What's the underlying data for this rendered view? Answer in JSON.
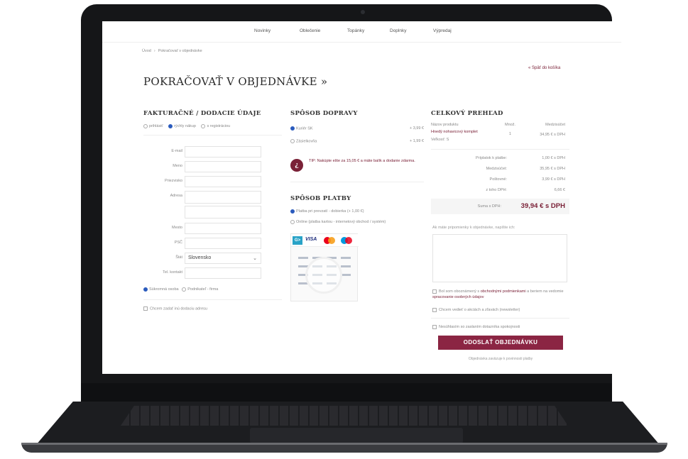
{
  "nav": {
    "items": [
      "Novinky",
      "Oblečenie",
      "Topánky",
      "Doplnky",
      "Výpredaj"
    ]
  },
  "breadcrumb": {
    "home": "Úvod",
    "current": "Pokračovať v objednávke"
  },
  "back_link": "« Späť do košíka",
  "page_title": "POKRAČOVAŤ V OBJEDNÁVKE »",
  "billing": {
    "title": "FAKTURAČNÉ / DODACIE ÚDAJE",
    "customer_types": [
      "prihlásiť",
      "rýchly nákup",
      "s registráciou"
    ],
    "fields": {
      "email": {
        "label": "E-mail",
        "value": ""
      },
      "first_name": {
        "label": "Meno",
        "value": ""
      },
      "last_name": {
        "label": "Priezvisko",
        "value": ""
      },
      "address": {
        "label": "Adresa",
        "value": ""
      },
      "city": {
        "label": "Mesto",
        "value": ""
      },
      "zip": {
        "label": "PSČ",
        "value": ""
      },
      "country": {
        "label": "Štát",
        "value": "Slovensko"
      },
      "phone": {
        "label": "Tel. kontakt",
        "value": ""
      }
    },
    "person_types": [
      "Súkromná osoba",
      "Podnikateľ - firma"
    ],
    "other_address": "Chcem zadať inú dodaciu adresu"
  },
  "shipping": {
    "title": "SPÔSOB DOPRAVY",
    "options": [
      {
        "label": "Kuriér SK",
        "price": "+ 3,99 €"
      },
      {
        "label": "Zásielkovňa",
        "price": "+ 1,99 €"
      }
    ],
    "tip": "TIP: Nakúpte ešte za 15,05 € a máte balík a dodanie zdarma."
  },
  "payment": {
    "title": "SPÔSOB PLATBY",
    "options": [
      "Platba pri prevzatí - dobierka (+ 1,00 €)",
      "Online (platba kartou - internetový obchod / systém)"
    ],
    "logo_visa": "VISA",
    "logo_gp": "G>"
  },
  "summary": {
    "title": "CELKOVÝ PREHĽAD",
    "headers": {
      "product": "Názov produktu",
      "qty": "Množ.",
      "subtotal": "Medzisúčet"
    },
    "item": {
      "name": "Hnedý nohavicový komplet",
      "variant": "Veľkosť: S",
      "qty": "1",
      "price": "34,95 € s DPH"
    },
    "rows": [
      {
        "label": "Príplatok k platbe:",
        "value": "1,00 € s DPH"
      },
      {
        "label": "Medzisúčet:",
        "value": "35,95 € s DPH"
      },
      {
        "label": "Poštovné:",
        "value": "3,99 € s DPH"
      },
      {
        "label": "z toho DPH:",
        "value": "6,66 €"
      }
    ],
    "total_label": "Suma s DPH:",
    "total_value": "39,94 € s DPH",
    "note_label": "Ak máte pripomienky k objednávke, napíšte ich:",
    "consents": [
      {
        "text": "Bol som oboznámený s ",
        "link": "obchodnými podmienkami",
        "after": " a beriem na vedomie ",
        "link2": "spracovanie osobných údajov"
      },
      {
        "text": "Chcem vedieť o akciách a zľavách (newsletter)"
      },
      {
        "text": "Nesúhlasím so zaslaním dotazníka spokojnosti"
      }
    ],
    "submit_label": "ODOSLAŤ OBJEDNÁVKU",
    "fineprint": "Objednávka zaväzuje k povinnosti platby"
  },
  "colors": {
    "accent": "#8b2543",
    "link": "#7a2137",
    "radio_selected": "#2b5bbd"
  }
}
